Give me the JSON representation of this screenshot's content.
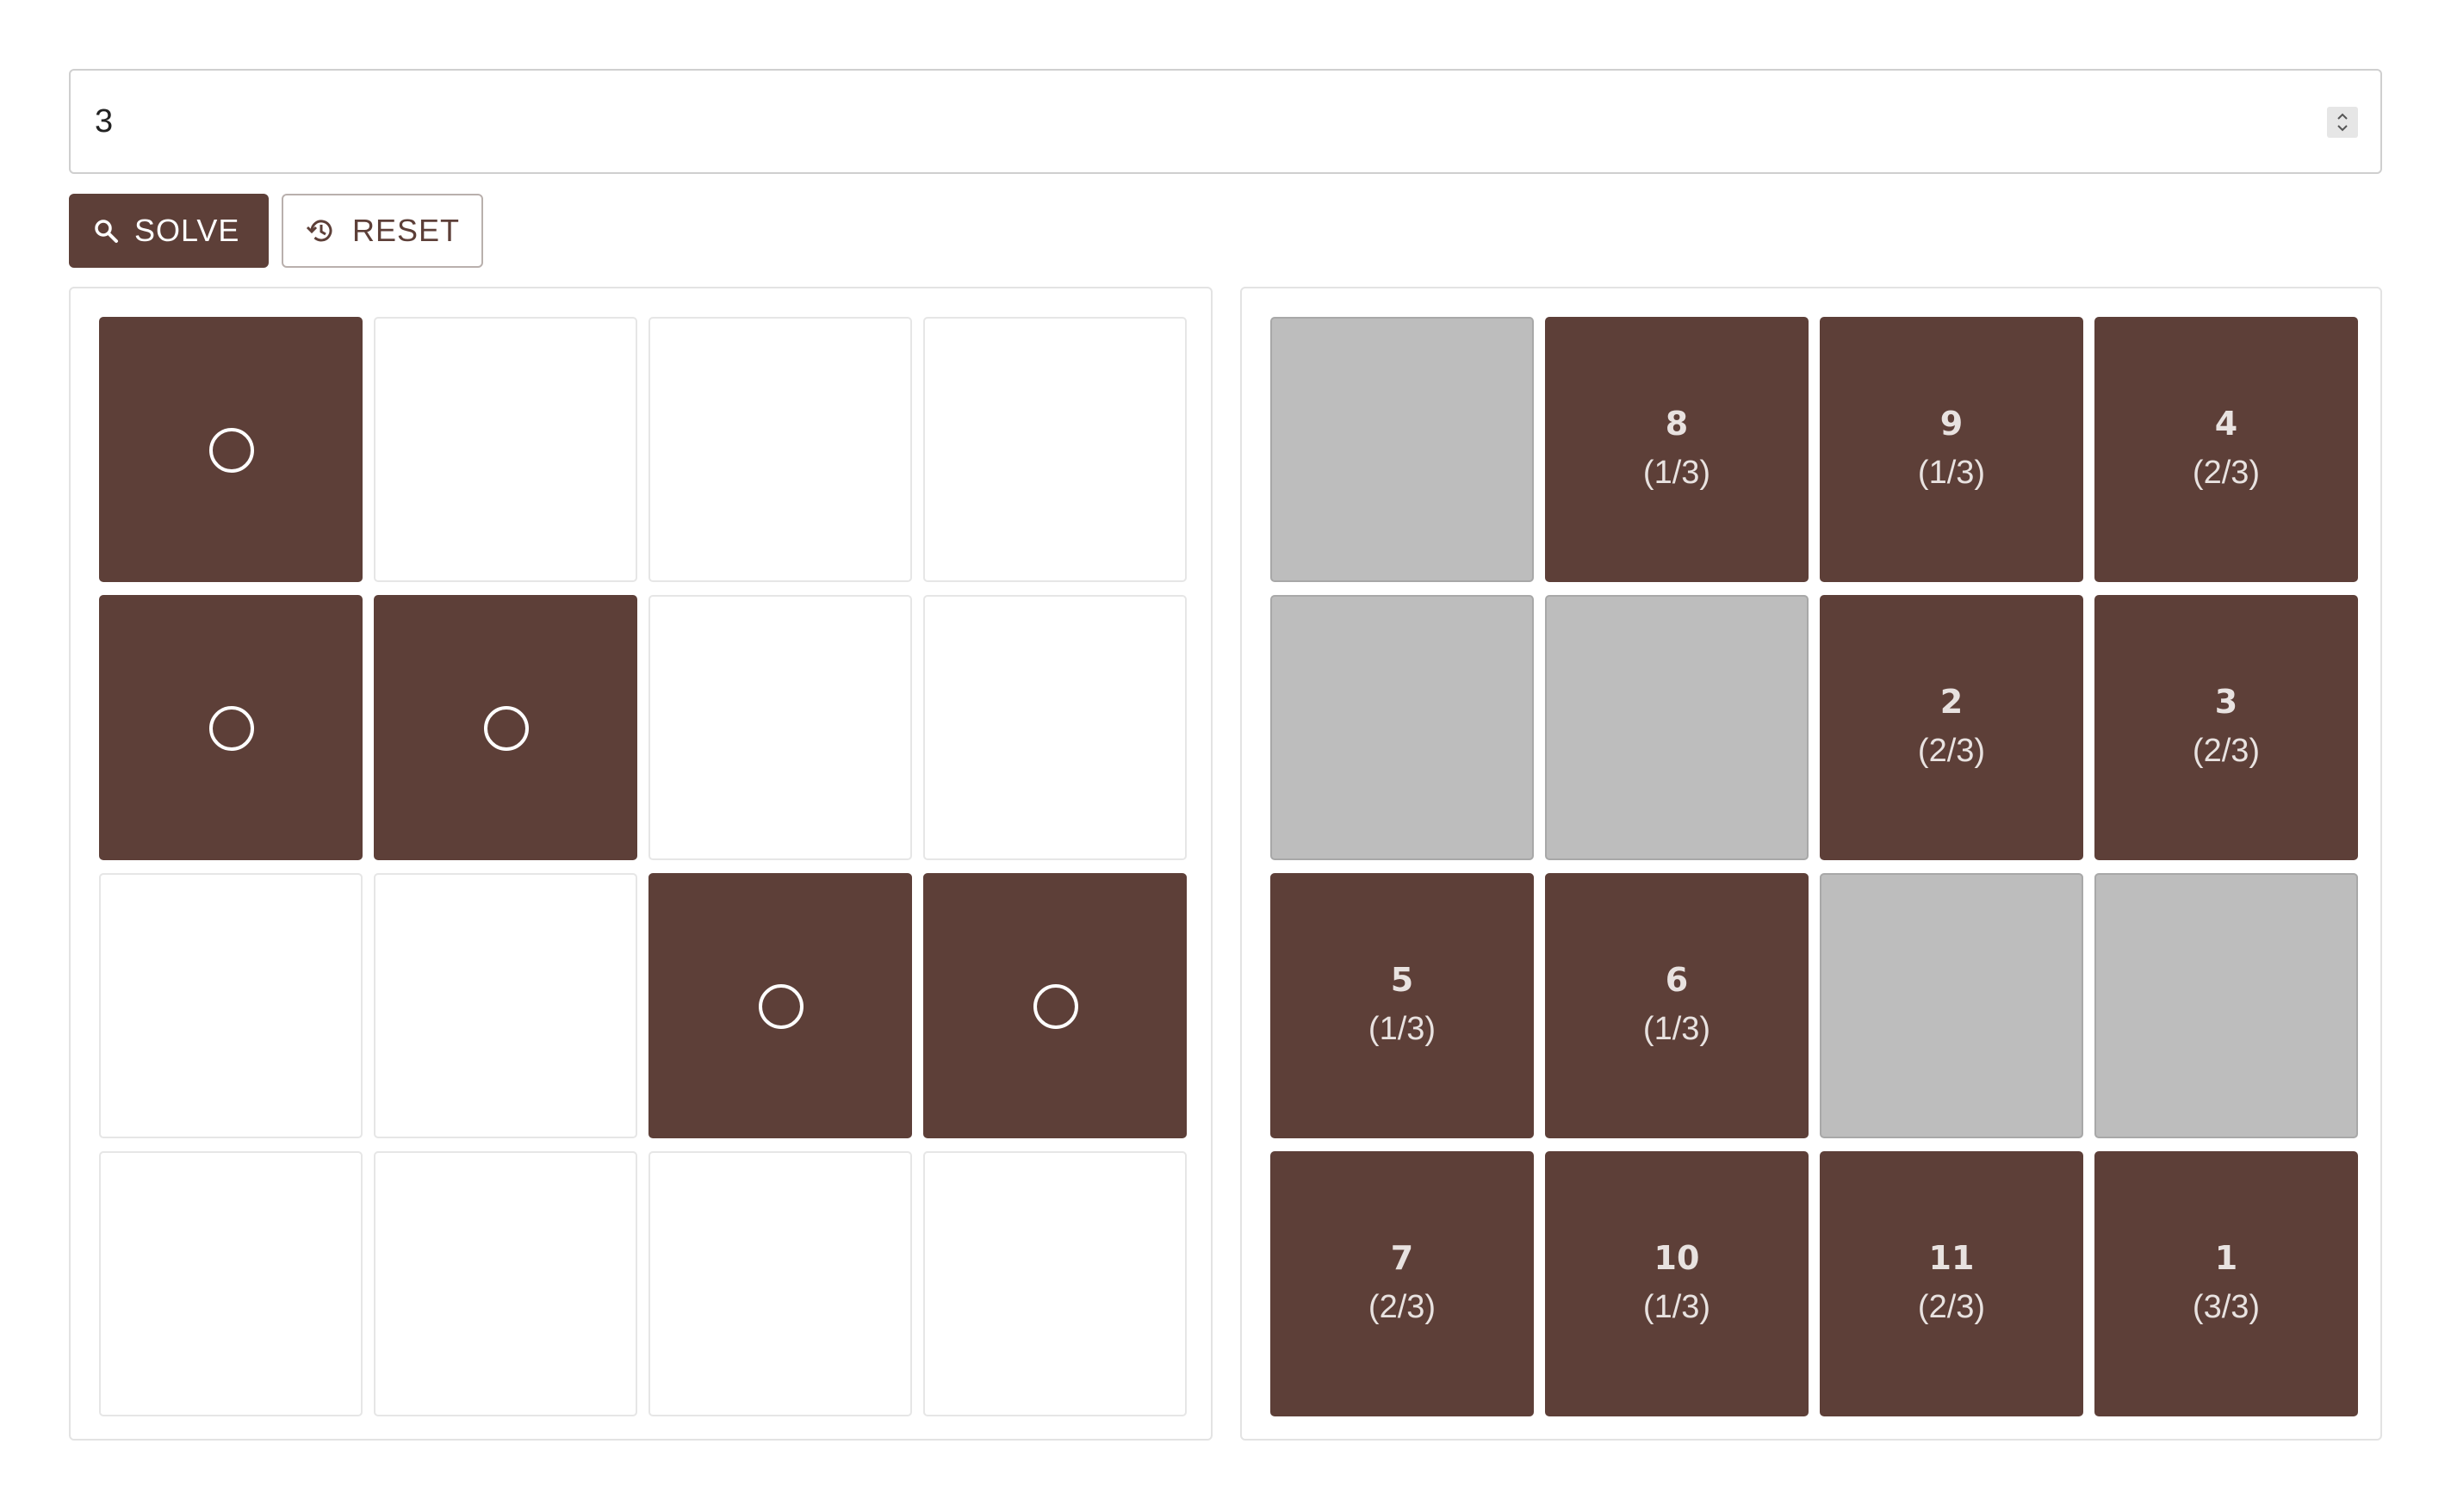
{
  "input": {
    "value": "3"
  },
  "buttons": {
    "solve_label": "SOLVE",
    "reset_label": "RESET"
  },
  "colors": {
    "accent": "#5d3f38",
    "gray_cell": "#bdbdbd"
  },
  "left_grid": {
    "rows": [
      [
        {
          "filled": true,
          "mark": "circle"
        },
        {
          "filled": false
        },
        {
          "filled": false
        },
        {
          "filled": false
        }
      ],
      [
        {
          "filled": true,
          "mark": "circle"
        },
        {
          "filled": true,
          "mark": "circle"
        },
        {
          "filled": false
        },
        {
          "filled": false
        }
      ],
      [
        {
          "filled": false
        },
        {
          "filled": false
        },
        {
          "filled": true,
          "mark": "circle"
        },
        {
          "filled": true,
          "mark": "circle"
        }
      ],
      [
        {
          "filled": false
        },
        {
          "filled": false
        },
        {
          "filled": false
        },
        {
          "filled": false
        }
      ]
    ]
  },
  "right_grid": {
    "rows": [
      [
        {
          "state": "gray"
        },
        {
          "state": "filled",
          "number": "8",
          "fraction": "(1/3)"
        },
        {
          "state": "filled",
          "number": "9",
          "fraction": "(1/3)"
        },
        {
          "state": "filled",
          "number": "4",
          "fraction": "(2/3)"
        }
      ],
      [
        {
          "state": "gray"
        },
        {
          "state": "gray"
        },
        {
          "state": "filled",
          "number": "2",
          "fraction": "(2/3)"
        },
        {
          "state": "filled",
          "number": "3",
          "fraction": "(2/3)"
        }
      ],
      [
        {
          "state": "filled",
          "number": "5",
          "fraction": "(1/3)"
        },
        {
          "state": "filled",
          "number": "6",
          "fraction": "(1/3)"
        },
        {
          "state": "gray"
        },
        {
          "state": "gray"
        }
      ],
      [
        {
          "state": "filled",
          "number": "7",
          "fraction": "(2/3)"
        },
        {
          "state": "filled",
          "number": "10",
          "fraction": "(1/3)"
        },
        {
          "state": "filled",
          "number": "11",
          "fraction": "(2/3)"
        },
        {
          "state": "filled",
          "number": "1",
          "fraction": "(3/3)"
        }
      ]
    ]
  }
}
